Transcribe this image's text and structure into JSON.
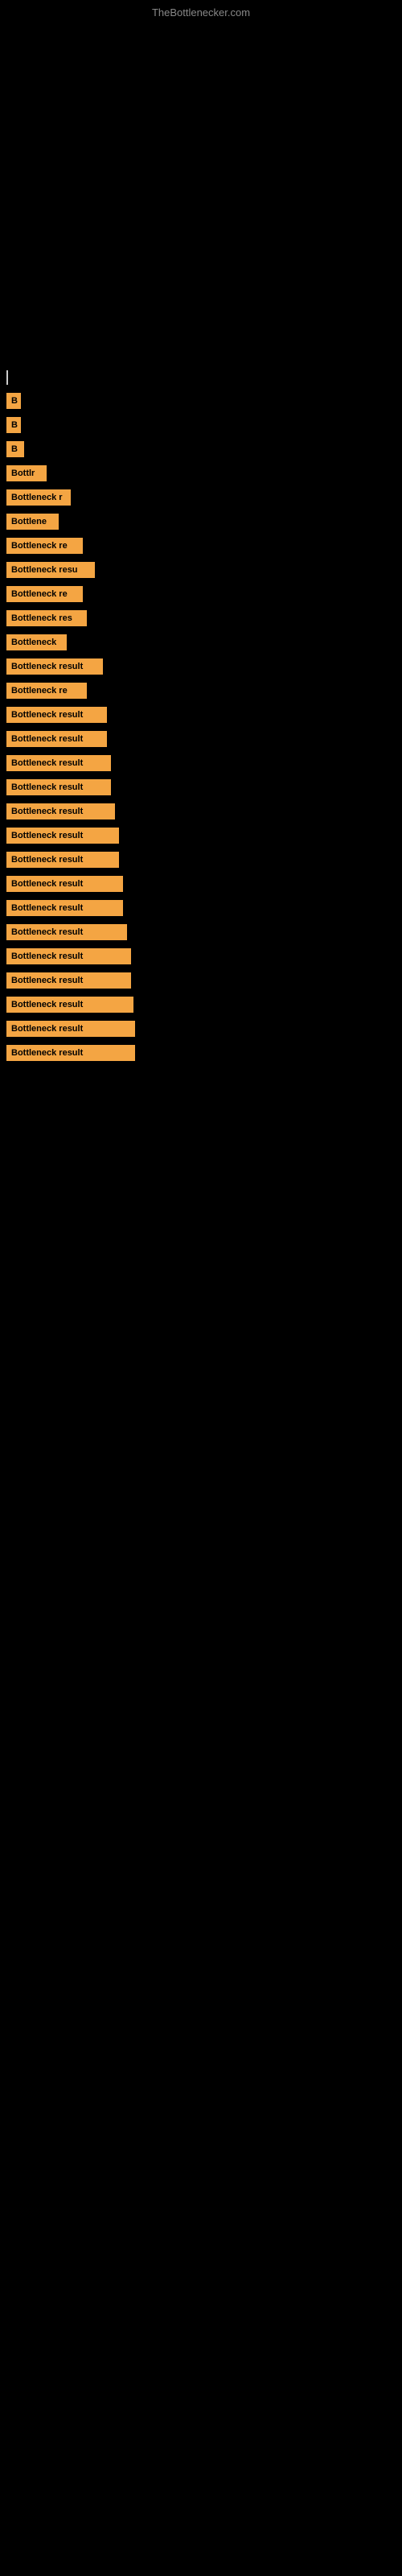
{
  "site": {
    "title": "TheBottlenecker.com"
  },
  "results": [
    {
      "id": 1,
      "label": "|",
      "size": "cursor",
      "width": 10
    },
    {
      "id": 2,
      "label": "B",
      "size": "xs",
      "width": 18
    },
    {
      "id": 3,
      "label": "B",
      "size": "xs",
      "width": 18
    },
    {
      "id": 4,
      "label": "B",
      "size": "xs",
      "width": 22
    },
    {
      "id": 5,
      "label": "Bottlr",
      "size": "sm",
      "width": 50
    },
    {
      "id": 6,
      "label": "Bottleneck r",
      "size": "md",
      "width": 80
    },
    {
      "id": 7,
      "label": "Bottlene",
      "size": "md",
      "width": 65
    },
    {
      "id": 8,
      "label": "Bottleneck re",
      "size": "lg",
      "width": 95
    },
    {
      "id": 9,
      "label": "Bottleneck resu",
      "size": "lg",
      "width": 110
    },
    {
      "id": 10,
      "label": "Bottleneck re",
      "size": "lg",
      "width": 95
    },
    {
      "id": 11,
      "label": "Bottleneck res",
      "size": "lg",
      "width": 100
    },
    {
      "id": 12,
      "label": "Bottleneck",
      "size": "md",
      "width": 75
    },
    {
      "id": 13,
      "label": "Bottleneck result",
      "size": "xl",
      "width": 120
    },
    {
      "id": 14,
      "label": "Bottleneck re",
      "size": "lg",
      "width": 100
    },
    {
      "id": 15,
      "label": "Bottleneck result",
      "size": "xl",
      "width": 125
    },
    {
      "id": 16,
      "label": "Bottleneck result",
      "size": "xl",
      "width": 125
    },
    {
      "id": 17,
      "label": "Bottleneck result",
      "size": "xl",
      "width": 130
    },
    {
      "id": 18,
      "label": "Bottleneck result",
      "size": "xl",
      "width": 130
    },
    {
      "id": 19,
      "label": "Bottleneck result",
      "size": "xl",
      "width": 135
    },
    {
      "id": 20,
      "label": "Bottleneck result",
      "size": "xxl",
      "width": 140
    },
    {
      "id": 21,
      "label": "Bottleneck result",
      "size": "xxl",
      "width": 140
    },
    {
      "id": 22,
      "label": "Bottleneck result",
      "size": "xxl",
      "width": 145
    },
    {
      "id": 23,
      "label": "Bottleneck result",
      "size": "xxl",
      "width": 145
    },
    {
      "id": 24,
      "label": "Bottleneck result",
      "size": "full",
      "width": 150
    },
    {
      "id": 25,
      "label": "Bottleneck result",
      "size": "full",
      "width": 155
    },
    {
      "id": 26,
      "label": "Bottleneck result",
      "size": "full",
      "width": 155
    },
    {
      "id": 27,
      "label": "Bottleneck result",
      "size": "full",
      "width": 158
    },
    {
      "id": 28,
      "label": "Bottleneck result",
      "size": "full",
      "width": 160
    },
    {
      "id": 29,
      "label": "Bottleneck result",
      "size": "full",
      "width": 160
    }
  ]
}
